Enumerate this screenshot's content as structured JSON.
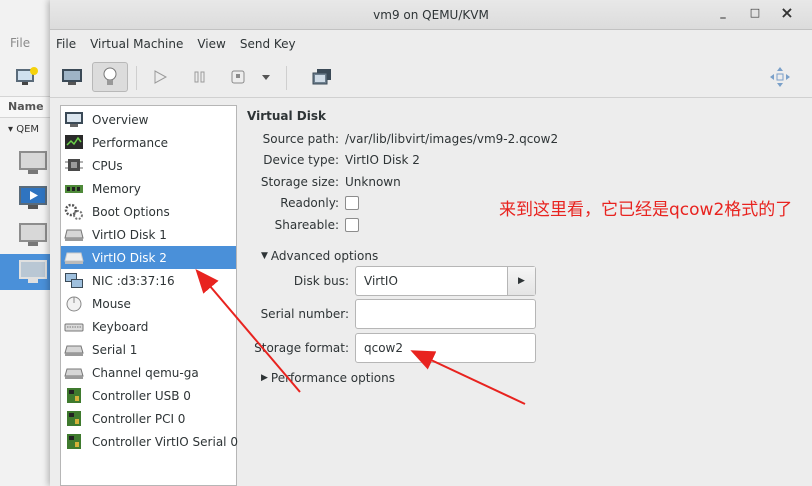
{
  "background_window": {
    "menu_file": "File",
    "column_name": "Name",
    "group_label": "QEM"
  },
  "window": {
    "title": "vm9 on QEMU/KVM",
    "minimize": "_",
    "maximize": "□",
    "close": "×"
  },
  "menu": {
    "file": "File",
    "virtual_machine": "Virtual Machine",
    "view": "View",
    "send_key": "Send Key"
  },
  "toolbar": {
    "icons": [
      "console-icon",
      "details-bulb-icon",
      "run-icon",
      "pause-icon",
      "shutdown-icon",
      "shutdown-dropdown-icon",
      "snapshots-icon",
      "fullscreen-icon"
    ]
  },
  "devices": [
    {
      "label": "Overview",
      "icon": "overview-icon"
    },
    {
      "label": "Performance",
      "icon": "performance-icon"
    },
    {
      "label": "CPUs",
      "icon": "cpu-icon"
    },
    {
      "label": "Memory",
      "icon": "memory-icon"
    },
    {
      "label": "Boot Options",
      "icon": "boot-options-icon"
    },
    {
      "label": "VirtIO Disk 1",
      "icon": "disk-icon"
    },
    {
      "label": "VirtIO Disk 2",
      "icon": "disk-icon",
      "selected": true
    },
    {
      "label": "NIC :d3:37:16",
      "icon": "nic-icon"
    },
    {
      "label": "Mouse",
      "icon": "mouse-icon"
    },
    {
      "label": "Keyboard",
      "icon": "keyboard-icon"
    },
    {
      "label": "Serial 1",
      "icon": "serial-icon"
    },
    {
      "label": "Channel qemu-ga",
      "icon": "channel-icon"
    },
    {
      "label": "Controller USB 0",
      "icon": "controller-icon"
    },
    {
      "label": "Controller PCI 0",
      "icon": "controller-icon"
    },
    {
      "label": "Controller VirtIO Serial 0",
      "icon": "controller-icon"
    }
  ],
  "details": {
    "section_title": "Virtual Disk",
    "source_path_label": "Source path:",
    "source_path_value": "/var/lib/libvirt/images/vm9-2.qcow2",
    "device_type_label": "Device type:",
    "device_type_value": "VirtIO Disk 2",
    "storage_size_label": "Storage size:",
    "storage_size_value": "Unknown",
    "readonly_label": "Readonly:",
    "readonly_checked": false,
    "shareable_label": "Shareable:",
    "shareable_checked": false,
    "advanced_options": "Advanced options",
    "disk_bus_label": "Disk bus:",
    "disk_bus_value": "VirtIO",
    "serial_number_label": "Serial number:",
    "serial_number_value": "",
    "storage_format_label": "Storage format:",
    "storage_format_value": "qcow2",
    "performance_options": "Performance options"
  },
  "annotation": {
    "text": "来到这里看，它已经是qcow2格式的了",
    "color": "#e8231f"
  },
  "colors": {
    "selection": "#4a90d9",
    "window_bg": "#ededed"
  }
}
